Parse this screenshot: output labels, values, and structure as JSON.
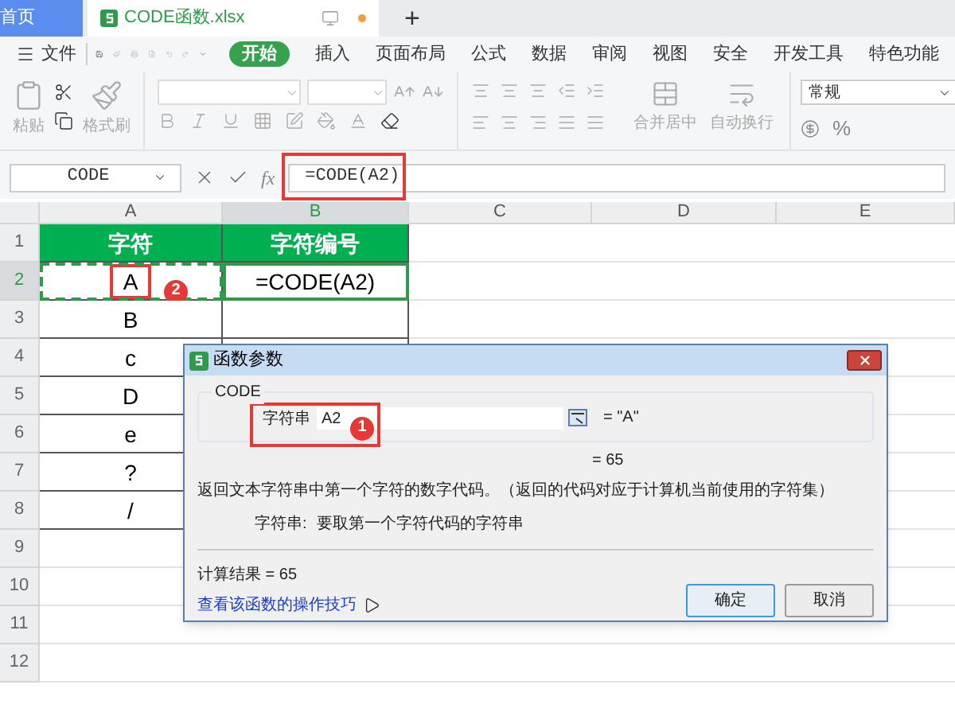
{
  "tabs": [
    {
      "label": "首页",
      "selected": false
    },
    {
      "label": "CODE函数.xlsx",
      "selected": true
    }
  ],
  "new_tab": "+",
  "menu": {
    "file": "文件",
    "tabs": [
      {
        "label": "开始",
        "selected": true
      },
      {
        "label": "插入",
        "selected": false
      },
      {
        "label": "页面布局",
        "selected": false
      },
      {
        "label": "公式",
        "selected": false
      },
      {
        "label": "数据",
        "selected": false
      },
      {
        "label": "审阅",
        "selected": false
      },
      {
        "label": "视图",
        "selected": false
      },
      {
        "label": "安全",
        "selected": false
      },
      {
        "label": "开发工具",
        "selected": false
      },
      {
        "label": "特色功能",
        "selected": false
      }
    ]
  },
  "ribbon": {
    "paste": "粘贴",
    "format_painter": "格式刷",
    "merge": "合并居中",
    "wrap": "自动换行",
    "number_format": "常规",
    "percent": "%"
  },
  "formula_bar": {
    "name_box": "CODE",
    "fx": "fx",
    "formula": "=CODE(A2)",
    "highlighted": true
  },
  "sheet": {
    "columns": [
      {
        "label": "A",
        "selected": false
      },
      {
        "label": "B",
        "selected": true
      },
      {
        "label": "C",
        "selected": false
      },
      {
        "label": "D",
        "selected": false
      },
      {
        "label": "E",
        "selected": false
      }
    ],
    "rows": [
      {
        "number": "1",
        "selected": false,
        "kind": "header",
        "cells": [
          {
            "kind": "text",
            "text": "字符",
            "active": false,
            "marquee": false,
            "highlighted": false
          },
          {
            "kind": "text",
            "text": "字符编号",
            "active": false,
            "marquee": false,
            "highlighted": false
          }
        ]
      },
      {
        "number": "2",
        "selected": true,
        "kind": "data",
        "badge": "2",
        "cells": [
          {
            "kind": "text",
            "text": "A",
            "active": false,
            "marquee": true,
            "highlighted": true
          },
          {
            "kind": "text",
            "text": "=CODE(A2)",
            "active": true,
            "marquee": false,
            "highlighted": false
          }
        ]
      },
      {
        "number": "3",
        "selected": false,
        "kind": "data",
        "cells": [
          {
            "kind": "text",
            "text": "B",
            "active": false,
            "marquee": false,
            "highlighted": false
          },
          {
            "kind": "blank"
          }
        ]
      },
      {
        "number": "4",
        "selected": false,
        "kind": "data",
        "cells": [
          {
            "kind": "text",
            "text": "c",
            "active": false,
            "marquee": false,
            "highlighted": false
          }
        ]
      },
      {
        "number": "5",
        "selected": false,
        "kind": "data",
        "cells": [
          {
            "kind": "text",
            "text": "D",
            "active": false,
            "marquee": false,
            "highlighted": false
          }
        ]
      },
      {
        "number": "6",
        "selected": false,
        "kind": "data",
        "cells": [
          {
            "kind": "text",
            "text": "e",
            "active": false,
            "marquee": false,
            "highlighted": false
          }
        ]
      },
      {
        "number": "7",
        "selected": false,
        "kind": "data",
        "cells": [
          {
            "kind": "text",
            "text": "?",
            "active": false,
            "marquee": false,
            "highlighted": false
          }
        ]
      },
      {
        "number": "8",
        "selected": false,
        "kind": "data",
        "cells": [
          {
            "kind": "text",
            "text": "/",
            "active": false,
            "marquee": false,
            "highlighted": false
          }
        ]
      },
      {
        "number": "9",
        "selected": false,
        "kind": "empty"
      },
      {
        "number": "10",
        "selected": false,
        "kind": "empty"
      },
      {
        "number": "11",
        "selected": false,
        "kind": "empty"
      },
      {
        "number": "12",
        "selected": false,
        "kind": "empty"
      }
    ]
  },
  "dialog": {
    "title": "函数参数",
    "function": "CODE",
    "argument": {
      "label": "字符串",
      "value": "A2",
      "badge": "1",
      "highlighted": true,
      "result": "= \"A\""
    },
    "value": "= 65",
    "description": "返回文本字符串中第一个字符的数字代码。（返回的代码对应于计算机当前使用的字符集）",
    "argument_help": {
      "label": "字符串:",
      "text": "要取第一个字符代码的字符串"
    },
    "result": "计算结果 = 65",
    "link": "查看该函数的操作技巧",
    "buttons": [
      {
        "label": "确定",
        "selected": true
      },
      {
        "label": "取消",
        "selected": false
      }
    ]
  }
}
